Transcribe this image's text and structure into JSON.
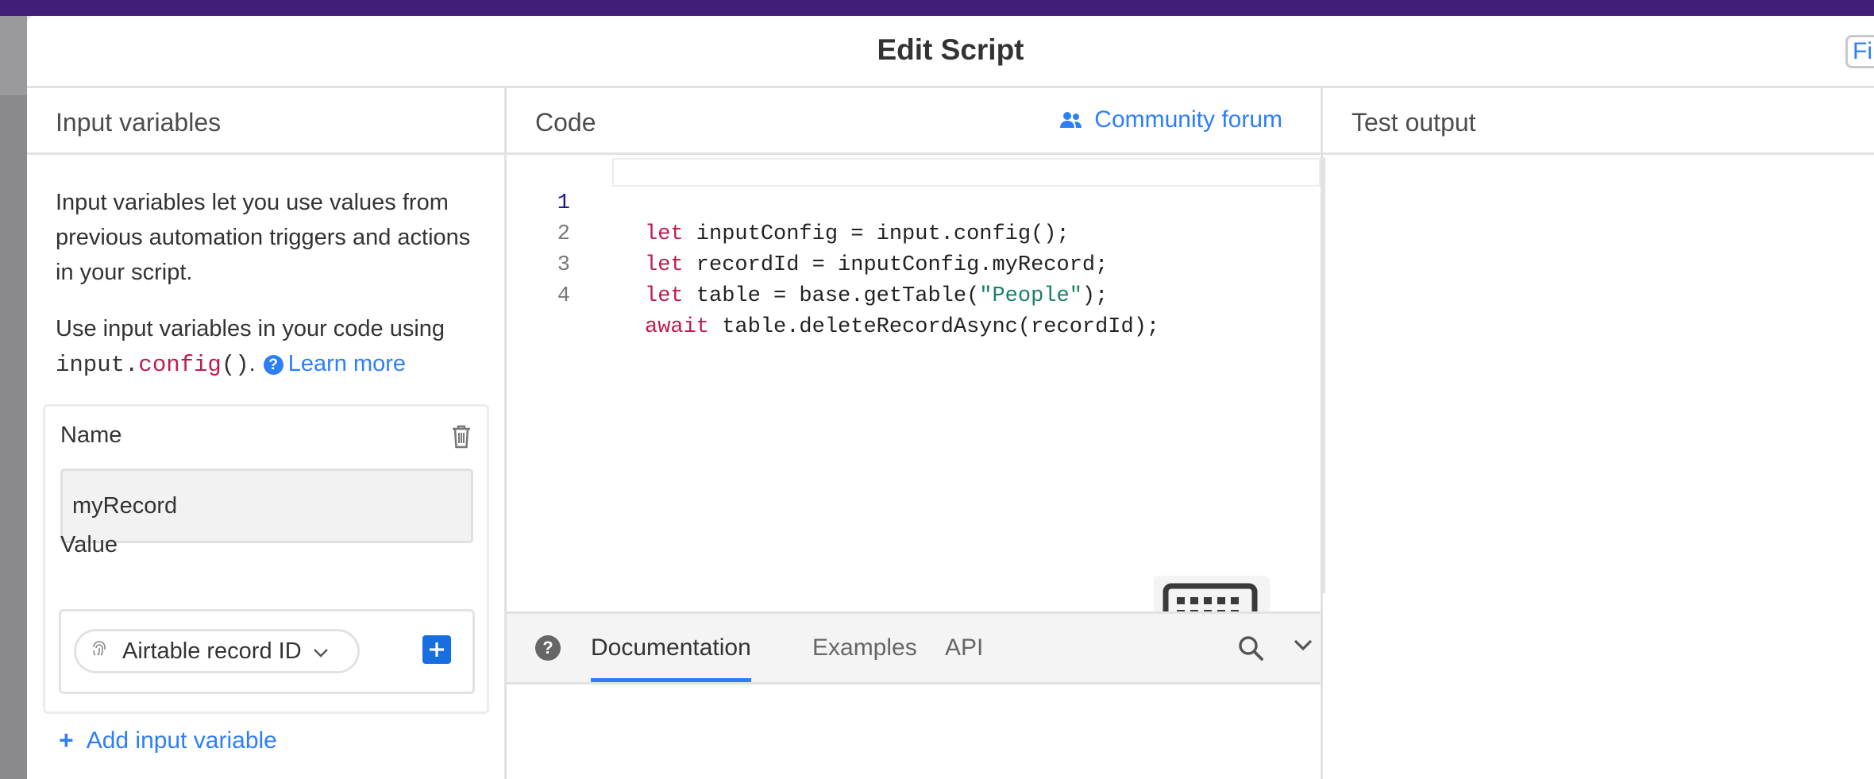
{
  "modal": {
    "title": "Edit Script",
    "finish_button": "Finish"
  },
  "input_panel": {
    "title": "Input variables",
    "description": "Input variables let you use values from previous automation triggers and actions in your script.",
    "usage_prefix": "Use input variables in your code using",
    "usage_code_object": "input.",
    "usage_code_method": "config",
    "usage_code_parens": "()",
    "usage_period": ".",
    "help_glyph": "?",
    "learn_more": "Learn more",
    "variable": {
      "name_label": "Name",
      "name_value": "myRecord",
      "value_label": "Value",
      "value_token": "Airtable record ID"
    },
    "add_variable": "Add input variable",
    "add_plus": "+"
  },
  "code_panel": {
    "title": "Code",
    "community_link": "Community forum",
    "lines": [
      {
        "number": "1",
        "kw": "let",
        "rest": " inputConfig = input.config();",
        "str": "",
        "tail": ""
      },
      {
        "number": "2",
        "kw": "let",
        "rest": " recordId = inputConfig.myRecord;",
        "str": "",
        "tail": ""
      },
      {
        "number": "3",
        "kw": "let",
        "rest": " table = base.getTable(",
        "str": "\"People\"",
        "tail": ");"
      },
      {
        "number": "4",
        "kw": "await",
        "rest": " table.deleteRecordAsync(recordId);",
        "str": "",
        "tail": ""
      }
    ],
    "docs_tabs": {
      "help_glyph": "?",
      "documentation": "Documentation",
      "examples": "Examples",
      "api": "API"
    }
  },
  "test_panel": {
    "title": "Test output"
  },
  "colors": {
    "accent": "#2d7ff9",
    "header_bar": "#3f1f78",
    "keyword": "#c01c4b",
    "string": "#1a7f6a"
  }
}
